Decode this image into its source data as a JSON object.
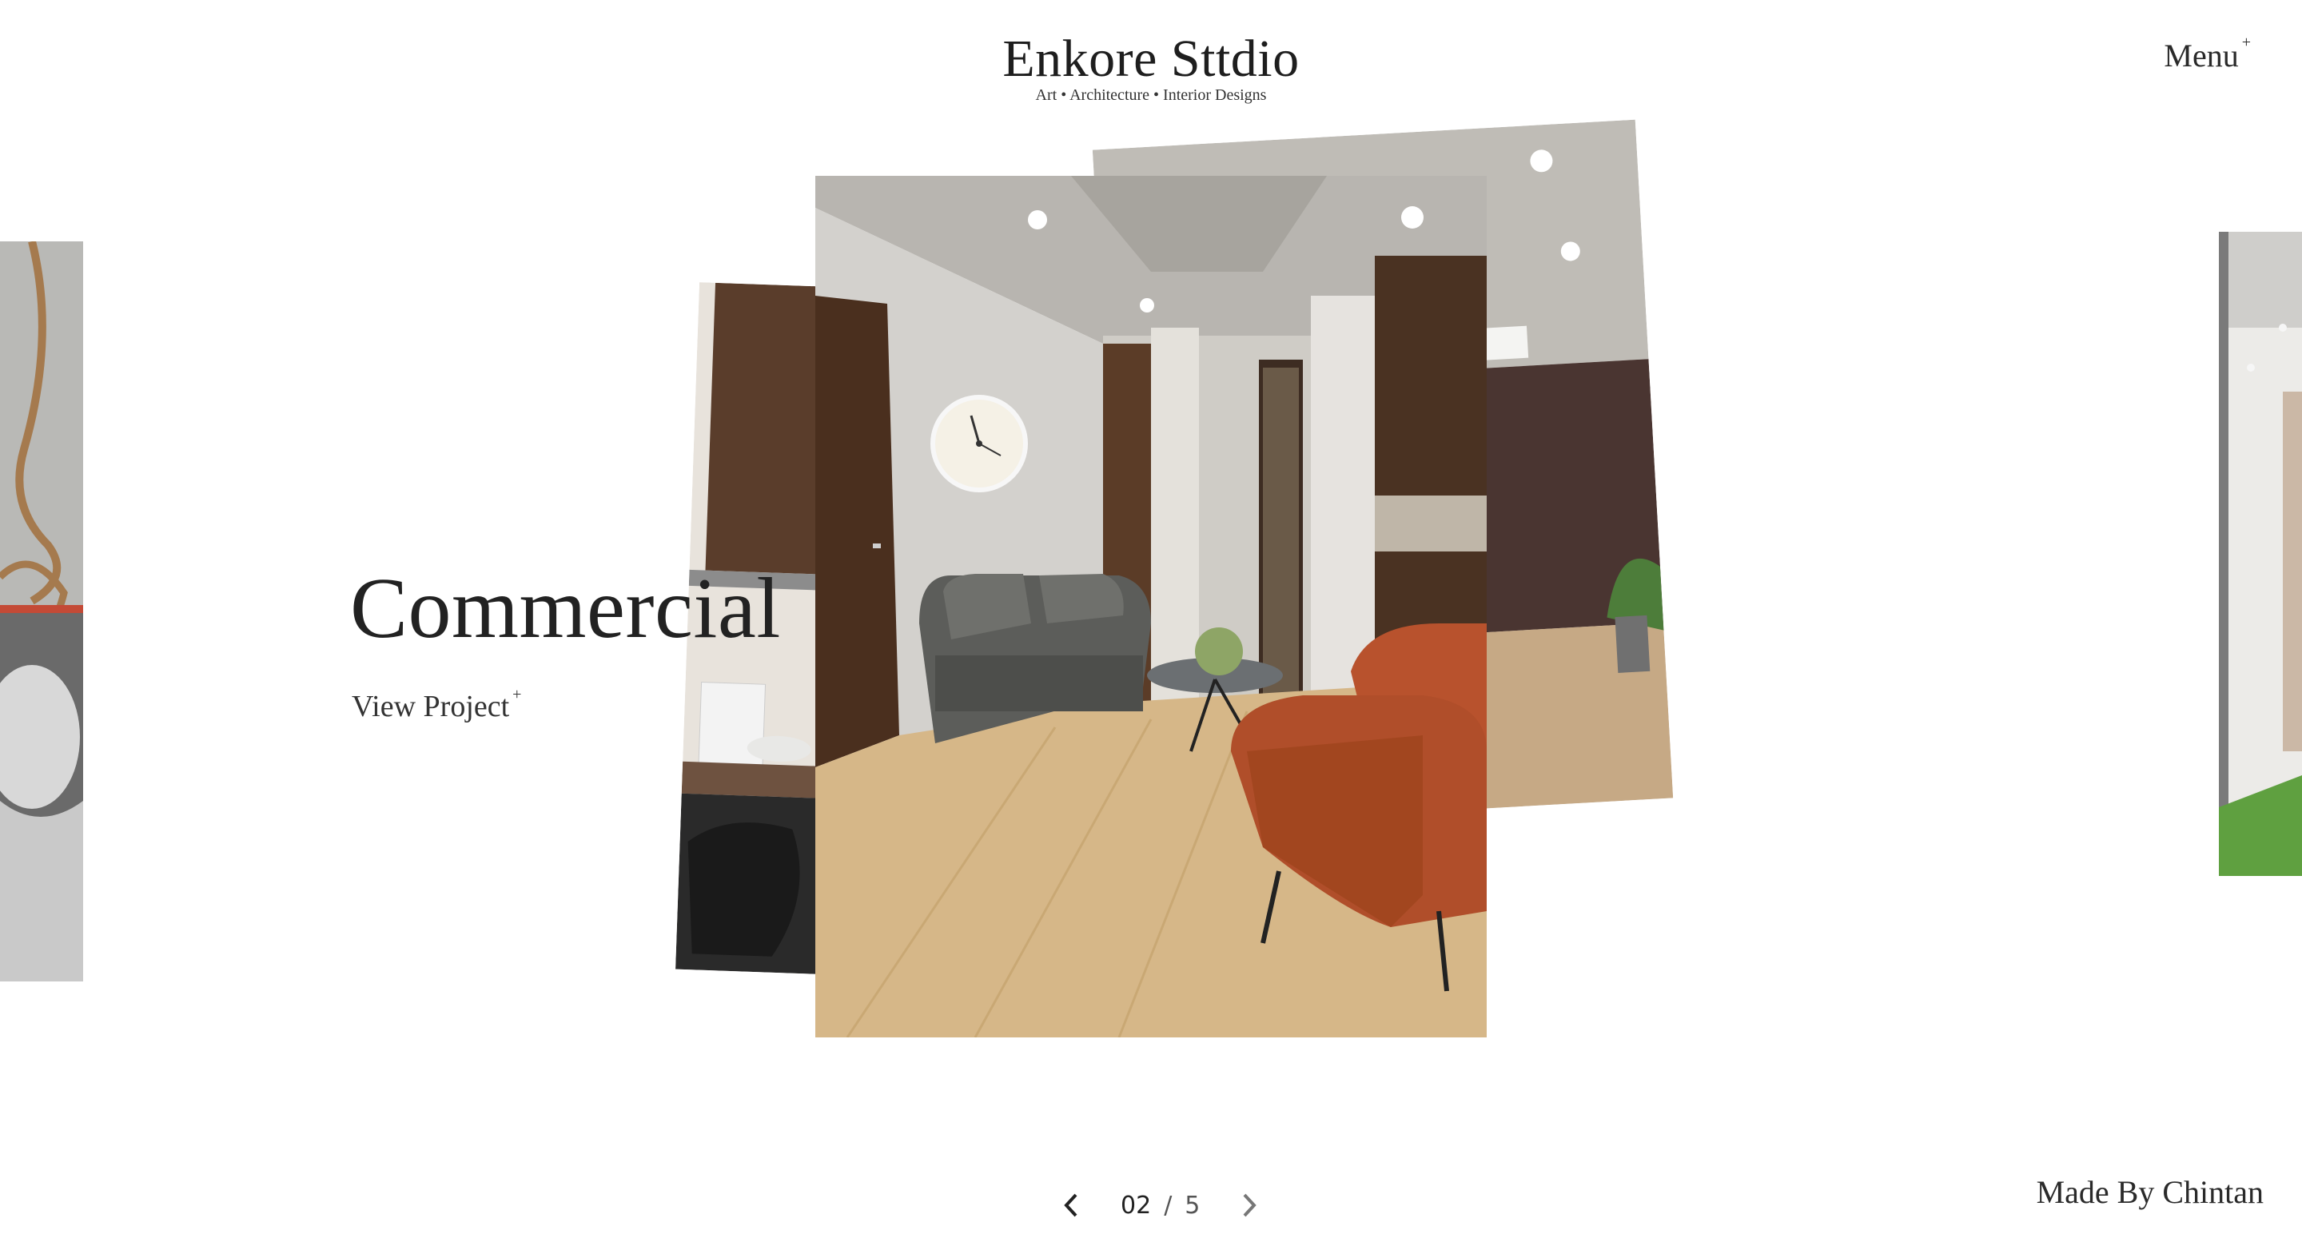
{
  "brand": {
    "title": "Enkore Sttdio",
    "tagline": "Art • Architecture • Interior Designs"
  },
  "nav": {
    "menu_label": "Menu",
    "menu_mark": "+"
  },
  "slide": {
    "heading": "Commercial",
    "cta_label": "View Project",
    "cta_mark": "+"
  },
  "pager": {
    "current": "02",
    "separator": "/",
    "total": "5",
    "prev_icon": "chevron-left-icon",
    "next_icon": "chevron-right-icon"
  },
  "footer": {
    "credit": "Made By Chintan"
  },
  "colors": {
    "text": "#222222",
    "background": "#ffffff",
    "wood": "#5a3d2b",
    "leather": "#b8522d",
    "floor": "#d6b788"
  }
}
